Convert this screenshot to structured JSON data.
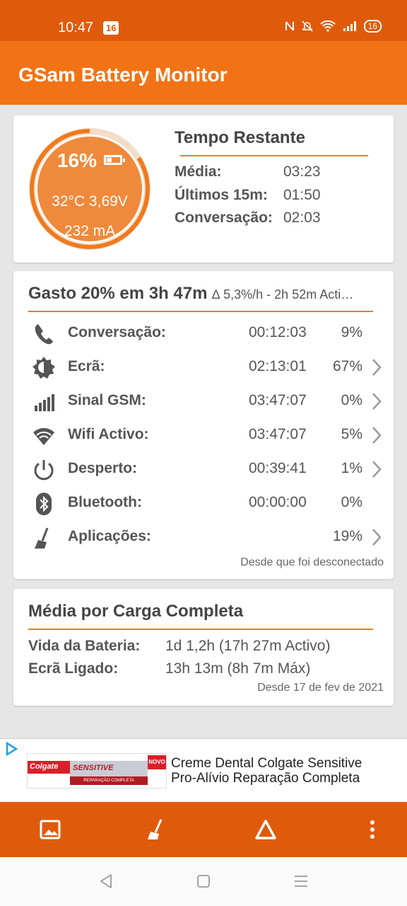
{
  "status_bar": {
    "time": "10:47",
    "notification_badge": "16",
    "battery": "16"
  },
  "app": {
    "title": "GSam Battery Monitor",
    "accent": "#f27315",
    "dark_accent": "#e05a0c"
  },
  "gauge": {
    "percent": "16%",
    "level": 0.16,
    "temp_voltage": "32°C  3,69V",
    "current": "232 mA"
  },
  "time_remaining": {
    "title": "Tempo Restante",
    "rows": [
      {
        "label": "Média:",
        "value": "03:23"
      },
      {
        "label": "Últimos 15m:",
        "value": "01:50"
      },
      {
        "label": "Conversação:",
        "value": "02:03"
      }
    ]
  },
  "usage": {
    "heading": "Gasto 20% em 3h 47m",
    "subheading": "∆ 5,3%/h - 2h 52m Acti…",
    "rows": [
      {
        "icon": "phone-icon",
        "label": "Conversação:",
        "time": "00:12:03",
        "pct": "9%",
        "chevron": false
      },
      {
        "icon": "brightness-icon",
        "label": "Ecrã:",
        "time": "02:13:01",
        "pct": "67%",
        "chevron": true
      },
      {
        "icon": "signal-icon",
        "label": "Sinal GSM:",
        "time": "03:47:07",
        "pct": "0%",
        "chevron": true
      },
      {
        "icon": "wifi-icon",
        "label": "Wifi Activo:",
        "time": "03:47:07",
        "pct": "5%",
        "chevron": true
      },
      {
        "icon": "power-icon",
        "label": "Desperto:",
        "time": "00:39:41",
        "pct": "1%",
        "chevron": true
      },
      {
        "icon": "bluetooth-icon",
        "label": "Bluetooth:",
        "time": "00:00:00",
        "pct": "0%",
        "chevron": false
      },
      {
        "icon": "apps-broom-icon",
        "label": "Aplicações:",
        "time": "",
        "pct": "19%",
        "chevron": true
      }
    ],
    "footer": "Desde que foi desconectado"
  },
  "full_charge": {
    "title": "Média por Carga Completa",
    "rows": [
      {
        "label": "Vida da Bateria:",
        "value": "1d 1,2h (17h 27m Activo)"
      },
      {
        "label": "Ecrã Ligado:",
        "value": "13h 13m (8h 7m Máx)"
      }
    ],
    "footer": "Desde 17 de fev de 2021"
  },
  "ad": {
    "brand": "Colgate",
    "product": "SENSITIVE",
    "badge": "NOVO",
    "subline": "REPARAÇÃO COMPLETA",
    "text_line1": "Creme Dental Colgate Sensitive",
    "text_line2": "Pro-Alívio Reparação Completa"
  },
  "bottom_bar": [
    "image-icon",
    "broom-icon",
    "delta-icon",
    "more-vert-icon"
  ],
  "nav_bar": [
    "back-icon",
    "home-icon",
    "menu-icon"
  ]
}
